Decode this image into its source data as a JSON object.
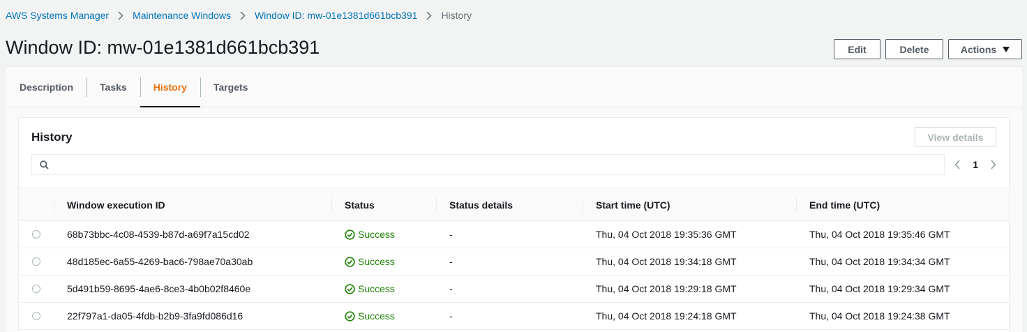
{
  "breadcrumb": {
    "items": [
      "AWS Systems Manager",
      "Maintenance Windows",
      "Window ID: mw-01e1381d661bcb391"
    ],
    "current": "History"
  },
  "page": {
    "title": "Window ID: mw-01e1381d661bcb391"
  },
  "header_buttons": {
    "edit": "Edit",
    "delete": "Delete",
    "actions": "Actions"
  },
  "tabs": [
    {
      "label": "Description",
      "active": false
    },
    {
      "label": "Tasks",
      "active": false
    },
    {
      "label": "History",
      "active": true
    },
    {
      "label": "Targets",
      "active": false
    }
  ],
  "history": {
    "title": "History",
    "view_details_label": "View details",
    "search_placeholder": "",
    "page_number": "1",
    "columns": [
      "Window execution ID",
      "Status",
      "Status details",
      "Start time (UTC)",
      "End time (UTC)"
    ],
    "rows": [
      {
        "id": "68b73bbc-4c08-4539-b87d-a69f7a15cd02",
        "status": "Success",
        "details": "-",
        "start": "Thu, 04 Oct 2018 19:35:36 GMT",
        "end": "Thu, 04 Oct 2018 19:35:46 GMT"
      },
      {
        "id": "48d185ec-6a55-4269-bac6-798ae70a30ab",
        "status": "Success",
        "details": "-",
        "start": "Thu, 04 Oct 2018 19:34:18 GMT",
        "end": "Thu, 04 Oct 2018 19:34:34 GMT"
      },
      {
        "id": "5d491b59-8695-4ae6-8ce3-4b0b02f8460e",
        "status": "Success",
        "details": "-",
        "start": "Thu, 04 Oct 2018 19:29:18 GMT",
        "end": "Thu, 04 Oct 2018 19:29:34 GMT"
      },
      {
        "id": "22f797a1-da05-4fdb-b2b9-3fa9fd086d16",
        "status": "Success",
        "details": "-",
        "start": "Thu, 04 Oct 2018 19:24:18 GMT",
        "end": "Thu, 04 Oct 2018 19:24:38 GMT"
      }
    ]
  },
  "colors": {
    "link": "#0073bb",
    "active_tab": "#ec7211",
    "success": "#1d8102"
  },
  "icons": [
    "chevron-right-icon",
    "caret-down-icon",
    "search-icon",
    "chevron-left-icon",
    "check-circle-icon"
  ]
}
